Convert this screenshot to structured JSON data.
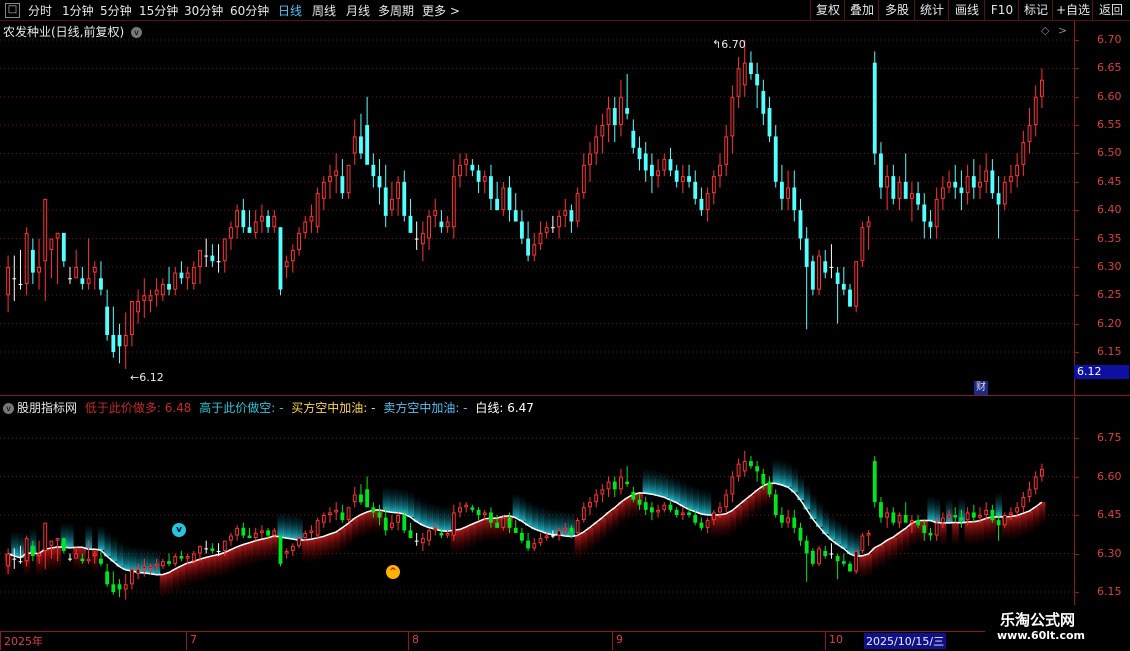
{
  "toolbar": {
    "periods": [
      "分时",
      "1分钟",
      "5分钟",
      "15分钟",
      "30分钟",
      "60分钟",
      "日线",
      "周线",
      "月线",
      "多周期",
      "更多 >"
    ],
    "active_period": "日线",
    "buttons": [
      "复权",
      "叠加",
      "多股",
      "统计",
      "画线",
      "F10",
      "标记",
      "+自选",
      "返回"
    ]
  },
  "main": {
    "title": "农发种业(日线,前复权)",
    "y_ticks": [
      "6.70",
      "6.65",
      "6.60",
      "6.55",
      "6.50",
      "6.45",
      "6.40",
      "6.35",
      "6.30",
      "6.25",
      "6.20",
      "6.15"
    ],
    "high_label": "6.70",
    "low_label": "6.12",
    "current_price": "6.12",
    "finance_badge": "财"
  },
  "indicator": {
    "name": "股朋指标网",
    "legend": [
      {
        "text": "低于此价做多: 6.48",
        "color": "#c62828"
      },
      {
        "text": "高于此价做空: -",
        "color": "#26c6da"
      },
      {
        "text": "买方空中加油: -",
        "color": "#ffd54f"
      },
      {
        "text": "卖方空中加油: -",
        "color": "#4fc3f7"
      },
      {
        "text": "白线: 6.47",
        "color": "#ffffff"
      }
    ],
    "y_ticks": [
      "6.75",
      "6.60",
      "6.45",
      "6.30",
      "6.15"
    ]
  },
  "dates": {
    "labels": [
      "2025年",
      "7",
      "8",
      "9",
      "10"
    ],
    "current": "2025/10/15/三"
  },
  "watermark": {
    "line1": "乐淘公式网",
    "line2": "www.60lt.com"
  },
  "colors": {
    "up": "#ff3333",
    "down": "#54ffff",
    "down_sub": "#00e61c",
    "grid": "#8b1a1a",
    "active": "#4fc3f7"
  },
  "chart_data": {
    "type": "candlestick",
    "title": "农发种业(日线,前复权)",
    "ylim": [
      6.12,
      6.72
    ],
    "y_ticks": [
      6.7,
      6.65,
      6.6,
      6.55,
      6.5,
      6.45,
      6.4,
      6.35,
      6.3,
      6.25,
      6.2,
      6.15
    ],
    "candles": [
      {
        "o": 6.25,
        "h": 6.32,
        "l": 6.22,
        "c": 6.3
      },
      {
        "o": 6.28,
        "h": 6.32,
        "l": 6.24,
        "c": 6.28
      },
      {
        "o": 6.27,
        "h": 6.33,
        "l": 6.26,
        "c": 6.27
      },
      {
        "o": 6.27,
        "h": 6.37,
        "l": 6.25,
        "c": 6.36
      },
      {
        "o": 6.33,
        "h": 6.35,
        "l": 6.27,
        "c": 6.29
      },
      {
        "o": 6.29,
        "h": 6.35,
        "l": 6.26,
        "c": 6.3
      },
      {
        "o": 6.31,
        "h": 6.37,
        "l": 6.24,
        "c": 6.42
      },
      {
        "o": 6.33,
        "h": 6.35,
        "l": 6.28,
        "c": 6.35
      },
      {
        "o": 6.35,
        "h": 6.36,
        "l": 6.27,
        "c": 6.36
      },
      {
        "o": 6.36,
        "h": 6.36,
        "l": 6.3,
        "c": 6.31
      },
      {
        "o": 6.28,
        "h": 6.3,
        "l": 6.27,
        "c": 6.28
      },
      {
        "o": 6.28,
        "h": 6.33,
        "l": 6.28,
        "c": 6.3
      },
      {
        "o": 6.28,
        "h": 6.3,
        "l": 6.26,
        "c": 6.27
      },
      {
        "o": 6.27,
        "h": 6.35,
        "l": 6.26,
        "c": 6.28
      },
      {
        "o": 6.29,
        "h": 6.31,
        "l": 6.26,
        "c": 6.3
      },
      {
        "o": 6.28,
        "h": 6.31,
        "l": 6.25,
        "c": 6.26
      },
      {
        "o": 6.23,
        "h": 6.26,
        "l": 6.17,
        "c": 6.18
      },
      {
        "o": 6.18,
        "h": 6.23,
        "l": 6.14,
        "c": 6.15
      },
      {
        "o": 6.18,
        "h": 6.2,
        "l": 6.13,
        "c": 6.16
      },
      {
        "o": 6.16,
        "h": 6.22,
        "l": 6.12,
        "c": 6.18
      },
      {
        "o": 6.18,
        "h": 6.24,
        "l": 6.16,
        "c": 6.24
      },
      {
        "o": 6.22,
        "h": 6.26,
        "l": 6.2,
        "c": 6.24
      },
      {
        "o": 6.24,
        "h": 6.28,
        "l": 6.21,
        "c": 6.25
      },
      {
        "o": 6.24,
        "h": 6.26,
        "l": 6.22,
        "c": 6.25
      },
      {
        "o": 6.25,
        "h": 6.28,
        "l": 6.23,
        "c": 6.26
      },
      {
        "o": 6.25,
        "h": 6.28,
        "l": 6.24,
        "c": 6.27
      },
      {
        "o": 6.27,
        "h": 6.3,
        "l": 6.25,
        "c": 6.26
      },
      {
        "o": 6.26,
        "h": 6.3,
        "l": 6.25,
        "c": 6.29
      },
      {
        "o": 6.29,
        "h": 6.31,
        "l": 6.27,
        "c": 6.28
      },
      {
        "o": 6.28,
        "h": 6.3,
        "l": 6.26,
        "c": 6.29
      },
      {
        "o": 6.27,
        "h": 6.31,
        "l": 6.26,
        "c": 6.3
      },
      {
        "o": 6.3,
        "h": 6.33,
        "l": 6.27,
        "c": 6.33
      },
      {
        "o": 6.32,
        "h": 6.35,
        "l": 6.3,
        "c": 6.32
      },
      {
        "o": 6.32,
        "h": 6.34,
        "l": 6.3,
        "c": 6.31
      },
      {
        "o": 6.31,
        "h": 6.34,
        "l": 6.29,
        "c": 6.31
      },
      {
        "o": 6.31,
        "h": 6.35,
        "l": 6.29,
        "c": 6.35
      },
      {
        "o": 6.35,
        "h": 6.38,
        "l": 6.33,
        "c": 6.37
      },
      {
        "o": 6.37,
        "h": 6.41,
        "l": 6.35,
        "c": 6.4
      },
      {
        "o": 6.4,
        "h": 6.42,
        "l": 6.36,
        "c": 6.37
      },
      {
        "o": 6.37,
        "h": 6.4,
        "l": 6.36,
        "c": 6.36
      },
      {
        "o": 6.36,
        "h": 6.4,
        "l": 6.35,
        "c": 6.38
      },
      {
        "o": 6.38,
        "h": 6.41,
        "l": 6.36,
        "c": 6.39
      },
      {
        "o": 6.39,
        "h": 6.4,
        "l": 6.36,
        "c": 6.37
      },
      {
        "o": 6.37,
        "h": 6.4,
        "l": 6.36,
        "c": 6.39
      },
      {
        "o": 6.37,
        "h": 6.37,
        "l": 6.25,
        "c": 6.26
      },
      {
        "o": 6.3,
        "h": 6.32,
        "l": 6.28,
        "c": 6.31
      },
      {
        "o": 6.31,
        "h": 6.34,
        "l": 6.29,
        "c": 6.33
      },
      {
        "o": 6.33,
        "h": 6.37,
        "l": 6.32,
        "c": 6.36
      },
      {
        "o": 6.36,
        "h": 6.39,
        "l": 6.35,
        "c": 6.38
      },
      {
        "o": 6.38,
        "h": 6.41,
        "l": 6.36,
        "c": 6.39
      },
      {
        "o": 6.37,
        "h": 6.44,
        "l": 6.36,
        "c": 6.43
      },
      {
        "o": 6.42,
        "h": 6.46,
        "l": 6.4,
        "c": 6.45
      },
      {
        "o": 6.45,
        "h": 6.48,
        "l": 6.42,
        "c": 6.46
      },
      {
        "o": 6.46,
        "h": 6.5,
        "l": 6.43,
        "c": 6.47
      },
      {
        "o": 6.46,
        "h": 6.49,
        "l": 6.42,
        "c": 6.43
      },
      {
        "o": 6.43,
        "h": 6.48,
        "l": 6.42,
        "c": 6.48
      },
      {
        "o": 6.5,
        "h": 6.56,
        "l": 6.48,
        "c": 6.53
      },
      {
        "o": 6.53,
        "h": 6.57,
        "l": 6.49,
        "c": 6.5
      },
      {
        "o": 6.55,
        "h": 6.6,
        "l": 6.49,
        "c": 6.48
      },
      {
        "o": 6.48,
        "h": 6.5,
        "l": 6.44,
        "c": 6.46
      },
      {
        "o": 6.46,
        "h": 6.49,
        "l": 6.41,
        "c": 6.44
      },
      {
        "o": 6.44,
        "h": 6.48,
        "l": 6.37,
        "c": 6.39
      },
      {
        "o": 6.4,
        "h": 6.45,
        "l": 6.39,
        "c": 6.42
      },
      {
        "o": 6.42,
        "h": 6.46,
        "l": 6.39,
        "c": 6.45
      },
      {
        "o": 6.45,
        "h": 6.47,
        "l": 6.38,
        "c": 6.39
      },
      {
        "o": 6.39,
        "h": 6.42,
        "l": 6.36,
        "c": 6.36
      },
      {
        "o": 6.35,
        "h": 6.38,
        "l": 6.33,
        "c": 6.35
      },
      {
        "o": 6.34,
        "h": 6.38,
        "l": 6.31,
        "c": 6.36
      },
      {
        "o": 6.35,
        "h": 6.4,
        "l": 6.33,
        "c": 6.39
      },
      {
        "o": 6.39,
        "h": 6.42,
        "l": 6.37,
        "c": 6.4
      },
      {
        "o": 6.38,
        "h": 6.4,
        "l": 6.36,
        "c": 6.37
      },
      {
        "o": 6.37,
        "h": 6.39,
        "l": 6.36,
        "c": 6.38
      },
      {
        "o": 6.37,
        "h": 6.49,
        "l": 6.35,
        "c": 6.46
      },
      {
        "o": 6.46,
        "h": 6.5,
        "l": 6.44,
        "c": 6.48
      },
      {
        "o": 6.48,
        "h": 6.5,
        "l": 6.46,
        "c": 6.49
      },
      {
        "o": 6.48,
        "h": 6.49,
        "l": 6.46,
        "c": 6.47
      },
      {
        "o": 6.47,
        "h": 6.48,
        "l": 6.43,
        "c": 6.45
      },
      {
        "o": 6.45,
        "h": 6.47,
        "l": 6.43,
        "c": 6.46
      },
      {
        "o": 6.46,
        "h": 6.48,
        "l": 6.4,
        "c": 6.42
      },
      {
        "o": 6.42,
        "h": 6.45,
        "l": 6.4,
        "c": 6.4
      },
      {
        "o": 6.4,
        "h": 6.45,
        "l": 6.39,
        "c": 6.44
      },
      {
        "o": 6.44,
        "h": 6.46,
        "l": 6.38,
        "c": 6.4
      },
      {
        "o": 6.4,
        "h": 6.43,
        "l": 6.38,
        "c": 6.38
      },
      {
        "o": 6.38,
        "h": 6.4,
        "l": 6.34,
        "c": 6.35
      },
      {
        "o": 6.35,
        "h": 6.38,
        "l": 6.31,
        "c": 6.32
      },
      {
        "o": 6.32,
        "h": 6.36,
        "l": 6.31,
        "c": 6.34
      },
      {
        "o": 6.34,
        "h": 6.38,
        "l": 6.33,
        "c": 6.36
      },
      {
        "o": 6.36,
        "h": 6.38,
        "l": 6.35,
        "c": 6.37
      },
      {
        "o": 6.37,
        "h": 6.39,
        "l": 6.36,
        "c": 6.37
      },
      {
        "o": 6.37,
        "h": 6.4,
        "l": 6.35,
        "c": 6.39
      },
      {
        "o": 6.39,
        "h": 6.42,
        "l": 6.37,
        "c": 6.4
      },
      {
        "o": 6.4,
        "h": 6.41,
        "l": 6.36,
        "c": 6.38
      },
      {
        "o": 6.38,
        "h": 6.44,
        "l": 6.37,
        "c": 6.43
      },
      {
        "o": 6.43,
        "h": 6.5,
        "l": 6.42,
        "c": 6.48
      },
      {
        "o": 6.48,
        "h": 6.52,
        "l": 6.45,
        "c": 6.5
      },
      {
        "o": 6.5,
        "h": 6.55,
        "l": 6.48,
        "c": 6.53
      },
      {
        "o": 6.53,
        "h": 6.57,
        "l": 6.5,
        "c": 6.55
      },
      {
        "o": 6.55,
        "h": 6.6,
        "l": 6.52,
        "c": 6.58
      },
      {
        "o": 6.58,
        "h": 6.6,
        "l": 6.52,
        "c": 6.55
      },
      {
        "o": 6.55,
        "h": 6.63,
        "l": 6.53,
        "c": 6.6
      },
      {
        "o": 6.58,
        "h": 6.64,
        "l": 6.56,
        "c": 6.57
      },
      {
        "o": 6.54,
        "h": 6.56,
        "l": 6.5,
        "c": 6.51
      },
      {
        "o": 6.51,
        "h": 6.53,
        "l": 6.47,
        "c": 6.49
      },
      {
        "o": 6.5,
        "h": 6.52,
        "l": 6.45,
        "c": 6.47
      },
      {
        "o": 6.48,
        "h": 6.5,
        "l": 6.43,
        "c": 6.46
      },
      {
        "o": 6.46,
        "h": 6.49,
        "l": 6.44,
        "c": 6.47
      },
      {
        "o": 6.47,
        "h": 6.5,
        "l": 6.46,
        "c": 6.49
      },
      {
        "o": 6.49,
        "h": 6.51,
        "l": 6.46,
        "c": 6.47
      },
      {
        "o": 6.47,
        "h": 6.48,
        "l": 6.44,
        "c": 6.45
      },
      {
        "o": 6.45,
        "h": 6.48,
        "l": 6.43,
        "c": 6.46
      },
      {
        "o": 6.46,
        "h": 6.48,
        "l": 6.44,
        "c": 6.45
      },
      {
        "o": 6.45,
        "h": 6.47,
        "l": 6.41,
        "c": 6.42
      },
      {
        "o": 6.42,
        "h": 6.44,
        "l": 6.39,
        "c": 6.4
      },
      {
        "o": 6.4,
        "h": 6.44,
        "l": 6.38,
        "c": 6.43
      },
      {
        "o": 6.43,
        "h": 6.47,
        "l": 6.41,
        "c": 6.46
      },
      {
        "o": 6.46,
        "h": 6.5,
        "l": 6.44,
        "c": 6.48
      },
      {
        "o": 6.48,
        "h": 6.55,
        "l": 6.46,
        "c": 6.53
      },
      {
        "o": 6.53,
        "h": 6.62,
        "l": 6.5,
        "c": 6.6
      },
      {
        "o": 6.6,
        "h": 6.67,
        "l": 6.58,
        "c": 6.65
      },
      {
        "o": 6.62,
        "h": 6.7,
        "l": 6.6,
        "c": 6.66
      },
      {
        "o": 6.66,
        "h": 6.68,
        "l": 6.63,
        "c": 6.64
      },
      {
        "o": 6.64,
        "h": 6.66,
        "l": 6.58,
        "c": 6.62
      },
      {
        "o": 6.61,
        "h": 6.63,
        "l": 6.55,
        "c": 6.57
      },
      {
        "o": 6.58,
        "h": 6.6,
        "l": 6.52,
        "c": 6.53
      },
      {
        "o": 6.53,
        "h": 6.55,
        "l": 6.44,
        "c": 6.45
      },
      {
        "o": 6.45,
        "h": 6.48,
        "l": 6.4,
        "c": 6.42
      },
      {
        "o": 6.42,
        "h": 6.47,
        "l": 6.4,
        "c": 6.44
      },
      {
        "o": 6.44,
        "h": 6.47,
        "l": 6.38,
        "c": 6.4
      },
      {
        "o": 6.4,
        "h": 6.42,
        "l": 6.33,
        "c": 6.35
      },
      {
        "o": 6.35,
        "h": 6.37,
        "l": 6.19,
        "c": 6.3
      },
      {
        "o": 6.31,
        "h": 6.32,
        "l": 6.25,
        "c": 6.26
      },
      {
        "o": 6.26,
        "h": 6.33,
        "l": 6.25,
        "c": 6.32
      },
      {
        "o": 6.31,
        "h": 6.33,
        "l": 6.28,
        "c": 6.29
      },
      {
        "o": 6.3,
        "h": 6.34,
        "l": 6.28,
        "c": 6.3
      },
      {
        "o": 6.29,
        "h": 6.3,
        "l": 6.2,
        "c": 6.27
      },
      {
        "o": 6.27,
        "h": 6.3,
        "l": 6.25,
        "c": 6.26
      },
      {
        "o": 6.26,
        "h": 6.27,
        "l": 6.23,
        "c": 6.23
      },
      {
        "o": 6.23,
        "h": 6.31,
        "l": 6.22,
        "c": 6.31
      },
      {
        "o": 6.31,
        "h": 6.38,
        "l": 6.3,
        "c": 6.37
      },
      {
        "o": 6.37,
        "h": 6.39,
        "l": 6.33,
        "c": 6.38
      },
      {
        "o": 6.66,
        "h": 6.68,
        "l": 6.48,
        "c": 6.5
      },
      {
        "o": 6.5,
        "h": 6.52,
        "l": 6.42,
        "c": 6.44
      },
      {
        "o": 6.44,
        "h": 6.48,
        "l": 6.4,
        "c": 6.46
      },
      {
        "o": 6.46,
        "h": 6.48,
        "l": 6.41,
        "c": 6.42
      },
      {
        "o": 6.42,
        "h": 6.46,
        "l": 6.4,
        "c": 6.45
      },
      {
        "o": 6.45,
        "h": 6.5,
        "l": 6.42,
        "c": 6.42
      },
      {
        "o": 6.42,
        "h": 6.45,
        "l": 6.38,
        "c": 6.43
      },
      {
        "o": 6.43,
        "h": 6.45,
        "l": 6.4,
        "c": 6.41
      },
      {
        "o": 6.41,
        "h": 6.43,
        "l": 6.35,
        "c": 6.38
      },
      {
        "o": 6.38,
        "h": 6.4,
        "l": 6.35,
        "c": 6.37
      },
      {
        "o": 6.37,
        "h": 6.44,
        "l": 6.35,
        "c": 6.42
      },
      {
        "o": 6.42,
        "h": 6.46,
        "l": 6.4,
        "c": 6.44
      },
      {
        "o": 6.44,
        "h": 6.47,
        "l": 6.43,
        "c": 6.45
      },
      {
        "o": 6.45,
        "h": 6.48,
        "l": 6.42,
        "c": 6.44
      },
      {
        "o": 6.44,
        "h": 6.47,
        "l": 6.4,
        "c": 6.43
      },
      {
        "o": 6.43,
        "h": 6.48,
        "l": 6.41,
        "c": 6.46
      },
      {
        "o": 6.46,
        "h": 6.49,
        "l": 6.42,
        "c": 6.44
      },
      {
        "o": 6.44,
        "h": 6.48,
        "l": 6.42,
        "c": 6.45
      },
      {
        "o": 6.45,
        "h": 6.5,
        "l": 6.43,
        "c": 6.47
      },
      {
        "o": 6.47,
        "h": 6.49,
        "l": 6.42,
        "c": 6.43
      },
      {
        "o": 6.43,
        "h": 6.46,
        "l": 6.35,
        "c": 6.41
      },
      {
        "o": 6.41,
        "h": 6.46,
        "l": 6.4,
        "c": 6.45
      },
      {
        "o": 6.45,
        "h": 6.48,
        "l": 6.43,
        "c": 6.46
      },
      {
        "o": 6.46,
        "h": 6.5,
        "l": 6.44,
        "c": 6.48
      },
      {
        "o": 6.48,
        "h": 6.54,
        "l": 6.46,
        "c": 6.52
      },
      {
        "o": 6.52,
        "h": 6.58,
        "l": 6.5,
        "c": 6.55
      },
      {
        "o": 6.55,
        "h": 6.62,
        "l": 6.53,
        "c": 6.6
      },
      {
        "o": 6.6,
        "h": 6.65,
        "l": 6.58,
        "c": 6.63
      }
    ]
  }
}
